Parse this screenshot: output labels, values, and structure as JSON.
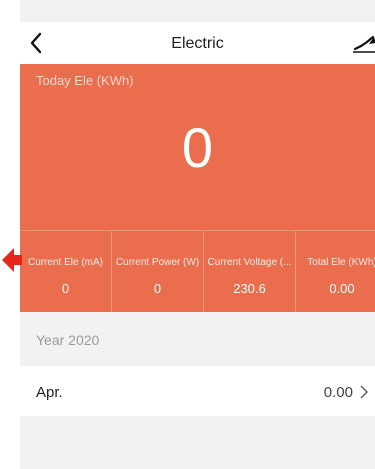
{
  "navbar": {
    "title": "Electric",
    "back_icon": "chevron-left-icon",
    "chart_icon": "line-chart-icon"
  },
  "today": {
    "label": "Today Ele (KWh)",
    "value": "0"
  },
  "stats": [
    {
      "label": "Current Ele (mA)",
      "value": "0"
    },
    {
      "label": "Current Power (W)",
      "value": "0"
    },
    {
      "label": "Current Voltage (...",
      "value": "230.6"
    },
    {
      "label": "Total Ele (KWh)",
      "value": "0.00"
    }
  ],
  "history": {
    "year_label": "Year 2020",
    "months": [
      {
        "name": "Apr.",
        "value": "0.00"
      }
    ]
  },
  "colors": {
    "accent": "#ea6e4e",
    "background": "#f2f2f2",
    "pointer": "#e8261c"
  }
}
